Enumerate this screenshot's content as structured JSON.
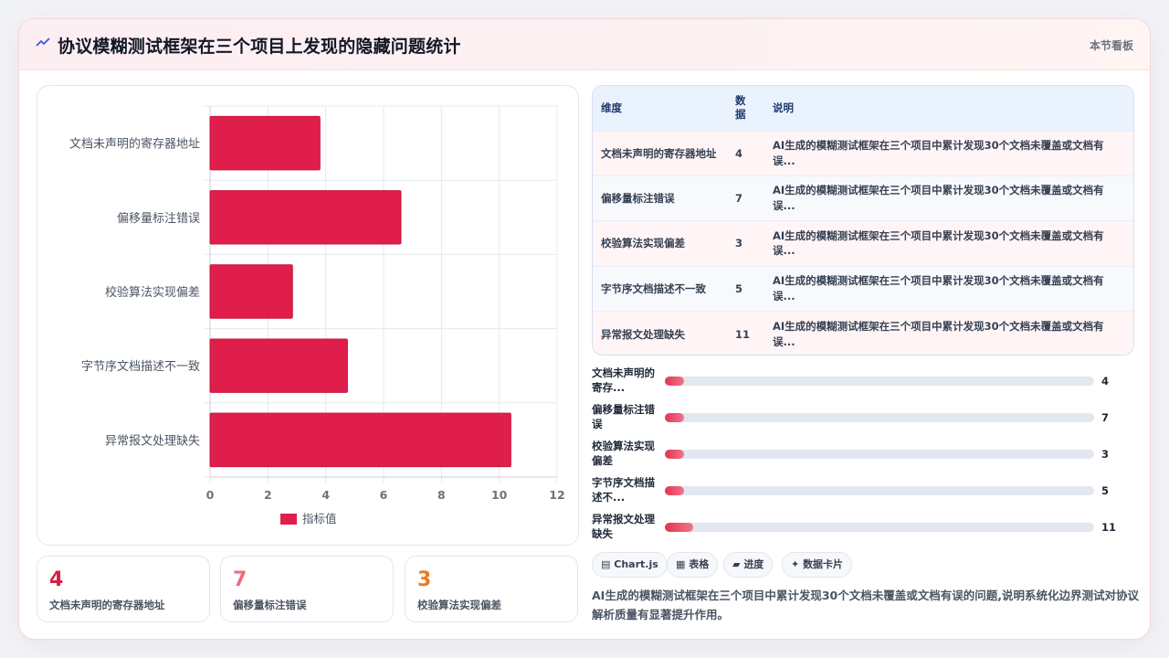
{
  "header": {
    "title": "协议模糊测试框架在三个项目上发现的隐藏问题统计",
    "board_label": "本节看板"
  },
  "chart_data": {
    "type": "bar",
    "orientation": "horizontal",
    "categories": [
      "文档未声明的寄存器地址",
      "偏移量标注错误",
      "校验算法实现偏差",
      "字节序文档描述不一致",
      "异常报文处理缺失"
    ],
    "series": [
      {
        "name": "指标值",
        "values": [
          3.8,
          6.6,
          2.85,
          4.75,
          10.4
        ],
        "color": "#e01e4b"
      }
    ],
    "xlim": [
      0,
      12
    ],
    "x_ticks": [
      "0",
      "2",
      "4",
      "6",
      "8",
      "10",
      "12"
    ],
    "grid": true,
    "legend": "bottom"
  },
  "stats": [
    {
      "value": "4",
      "label": "文档未声明的寄存器地址",
      "color": "#d61f45"
    },
    {
      "value": "7",
      "label": "偏移量标注错误",
      "color": "#f06a82"
    },
    {
      "value": "3",
      "label": "校验算法实现偏差",
      "color": "#ea7a21"
    }
  ],
  "table": {
    "headers": [
      "维度",
      "数据",
      "说明"
    ],
    "rows": [
      {
        "dim": "文档未声明的寄存器地址",
        "val": "4",
        "desc1": "AI生成的模糊测试框架在三个项目中累计发现30个文档未覆盖或文档有",
        "desc2": "误..."
      },
      {
        "dim": "偏移量标注错误",
        "val": "7",
        "desc1": "AI生成的模糊测试框架在三个项目中累计发现30个文档未覆盖或文档有",
        "desc2": "误..."
      },
      {
        "dim": "校验算法实现偏差",
        "val": "3",
        "desc1": "AI生成的模糊测试框架在三个项目中累计发现30个文档未覆盖或文档有",
        "desc2": "误..."
      },
      {
        "dim": "字节序文档描述不一致",
        "val": "5",
        "desc1": "AI生成的模糊测试框架在三个项目中累计发现30个文档未覆盖或文档有",
        "desc2": "误..."
      },
      {
        "dim": "异常报文处理缺失",
        "val": "11",
        "desc1": "AI生成的模糊测试框架在三个项目中累计发现30个文档未覆盖或文档有",
        "desc2": "误..."
      }
    ]
  },
  "progress": [
    {
      "label": "文档未声明的寄存...",
      "value": "4",
      "fraction": 0.045
    },
    {
      "label": "偏移量标注错误",
      "value": "7",
      "fraction": 0.045
    },
    {
      "label": "校验算法实现偏差",
      "value": "3",
      "fraction": 0.045
    },
    {
      "label": "字节序文档描述不...",
      "value": "5",
      "fraction": 0.045
    },
    {
      "label": "异常报文处理缺失",
      "value": "11",
      "fraction": 0.065
    }
  ],
  "chips": [
    {
      "icon": "chart-icon",
      "glyph": "▤",
      "label": "Chart.js"
    },
    {
      "icon": "table-icon",
      "glyph": "▦",
      "label": "表格"
    },
    {
      "icon": "progress-icon",
      "glyph": "▰",
      "label": "进度"
    },
    {
      "icon": "card-icon",
      "glyph": "✦",
      "label": "数据卡片"
    }
  ],
  "summary": "AI生成的模糊测试框架在三个项目中累计发现30个文档未覆盖或文档有误的问题,说明系统化边界测试对协议解析质量有显著提升作用。"
}
